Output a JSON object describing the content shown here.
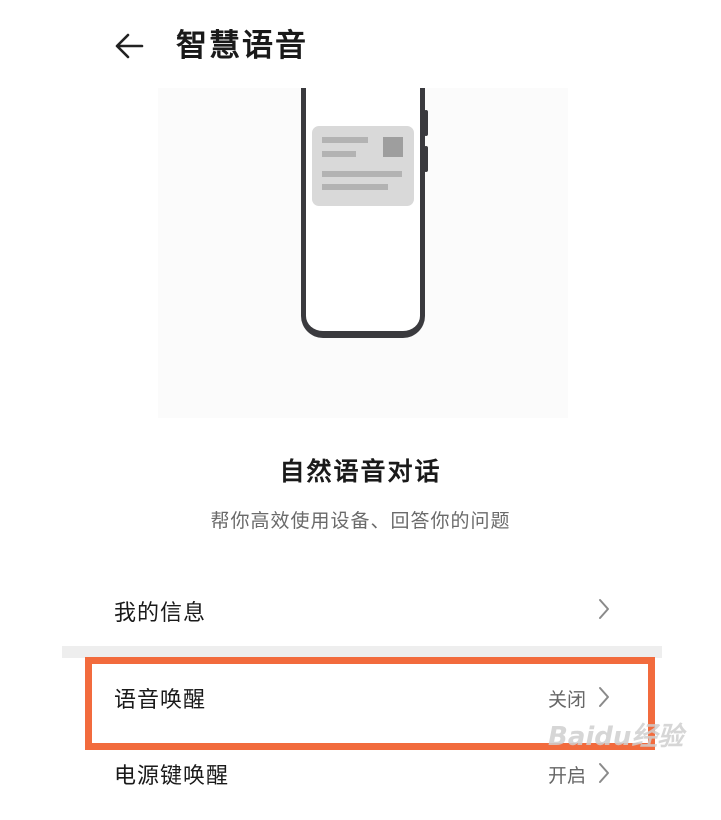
{
  "header": {
    "title": "智慧语音",
    "back_icon": "arrow-left-icon"
  },
  "feature": {
    "title": "自然语音对话",
    "subtitle": "帮你高效使用设备、回答你的问题",
    "illustration_icon": "phone-card-illustration"
  },
  "settings": [
    {
      "label": "我的信息",
      "value": ""
    },
    {
      "label": "语音唤醒",
      "value": "关闭"
    },
    {
      "label": "电源键唤醒",
      "value": "开启"
    }
  ],
  "highlight_color": "#f26b3d",
  "watermark": "Baidu经验"
}
